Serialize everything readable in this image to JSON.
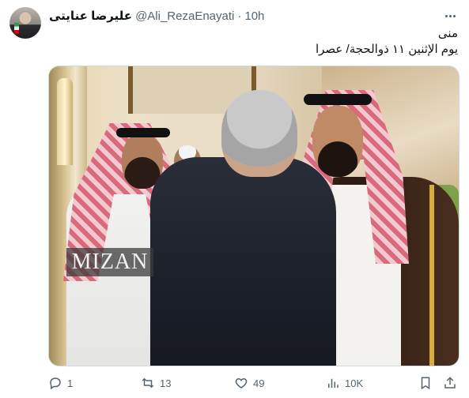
{
  "author": {
    "display_name": "علیرضا عنایتی",
    "handle": "@Ali_RezaEnayati",
    "separator": "·",
    "time": "10h"
  },
  "tweet": {
    "line1": "منی",
    "line2": "یوم الإثنین ۱۱ ذوالحجة/ عصرا"
  },
  "media": {
    "watermark": "MIZAN"
  },
  "actions": {
    "replies": "1",
    "retweets": "13",
    "likes": "49",
    "views": "10K"
  },
  "icons": {
    "more": "more-dots-icon",
    "reply": "reply-icon",
    "retweet": "retweet-icon",
    "like": "heart-icon",
    "views": "views-chart-icon",
    "bookmark": "bookmark-icon",
    "share": "share-icon"
  },
  "colors": {
    "text": "#0f1419",
    "secondary": "#536471",
    "border": "#cfd9de"
  }
}
